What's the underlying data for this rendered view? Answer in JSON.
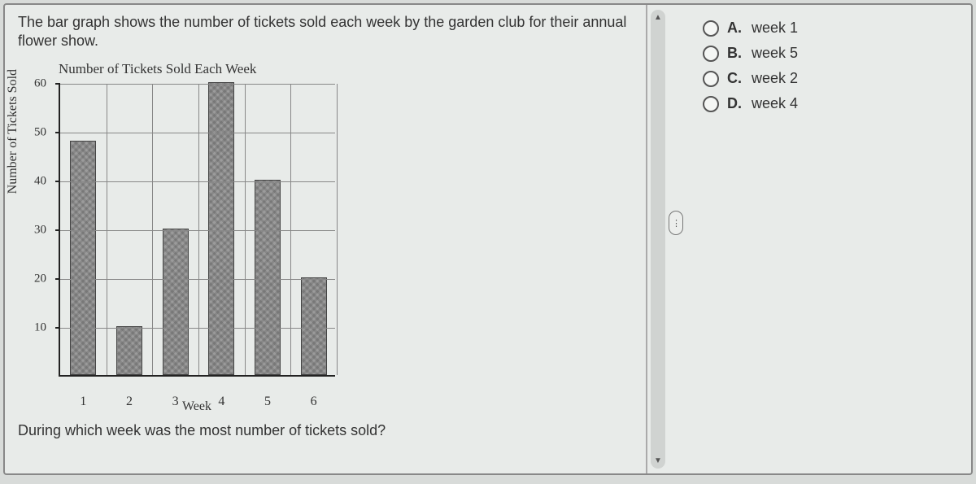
{
  "question_intro": "The bar graph shows the number of tickets sold each week by the garden club for their annual flower show.",
  "chart_title": "Number of Tickets Sold Each Week",
  "ylabel": "Number of Tickets Sold",
  "xlabel": "Week",
  "question_prompt": "During which week was the most number of tickets sold?",
  "options": [
    {
      "letter": "A.",
      "text": "week 1"
    },
    {
      "letter": "B.",
      "text": "week 5"
    },
    {
      "letter": "C.",
      "text": "week 2"
    },
    {
      "letter": "D.",
      "text": "week 4"
    }
  ],
  "expand_label": "⋮",
  "chart_data": {
    "type": "bar",
    "title": "Number of Tickets Sold Each Week",
    "xlabel": "Week",
    "ylabel": "Number of Tickets Sold",
    "categories": [
      "1",
      "2",
      "3",
      "4",
      "5",
      "6"
    ],
    "values": [
      48,
      10,
      30,
      60,
      40,
      20
    ],
    "y_ticks": [
      10,
      20,
      30,
      40,
      50,
      60
    ],
    "ylim": [
      0,
      60
    ]
  }
}
